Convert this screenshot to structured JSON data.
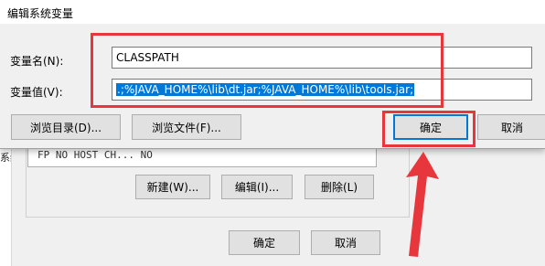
{
  "dialog": {
    "title": "编辑系统变量",
    "name_label": "变量名(N):",
    "value_label": "变量值(V):",
    "name_value": "CLASSPATH",
    "value_value": ".;%JAVA_HOME%\\lib\\dt.jar;%JAVA_HOME%\\lib\\tools.jar;",
    "browse_dir_label": "浏览目录(D)...",
    "browse_file_label": "浏览文件(F)...",
    "ok_label": "确定",
    "cancel_label": "取消"
  },
  "background": {
    "left_text": "系统",
    "list_row": "FP_NO_HOST_CH...    NO",
    "new_label": "新建(W)...",
    "edit_label": "编辑(I)...",
    "delete_label": "删除(L)",
    "ok_label": "确定",
    "cancel_label": "取消"
  },
  "colors": {
    "highlight": "#e8363d",
    "selection": "#0078d7"
  }
}
